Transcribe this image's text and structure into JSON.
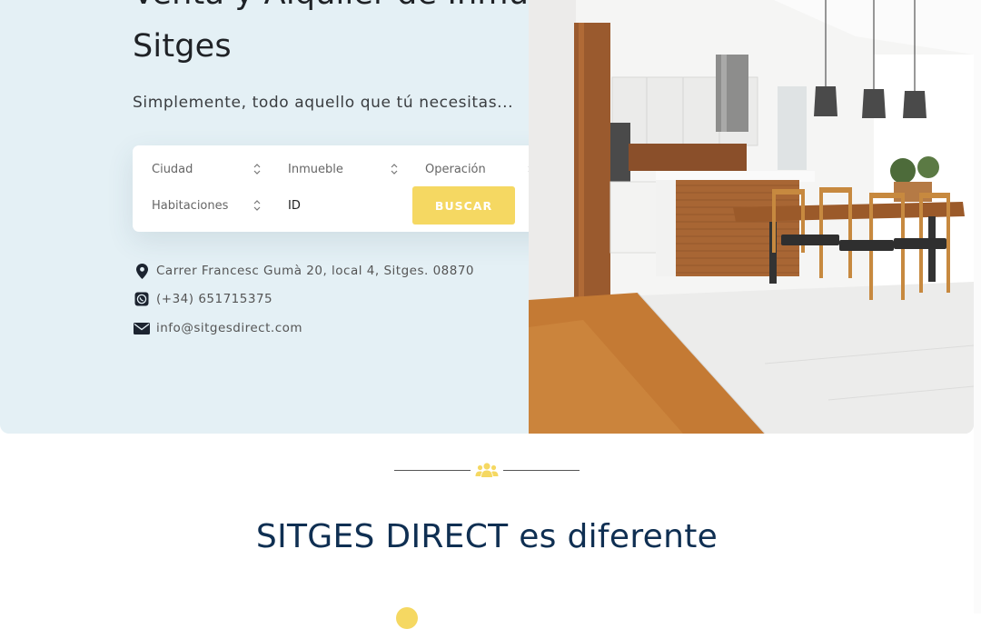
{
  "hero": {
    "title": "Venta y Alquiler de Inmuebles en Sitges",
    "subtitle": "Simplemente, todo aquello que tú necesitas..."
  },
  "search": {
    "fields": {
      "city": "Ciudad",
      "property": "Inmueble",
      "operation": "Operación",
      "rooms": "Habitaciones",
      "id_placeholder": "ID"
    },
    "button_label": "BUSCAR"
  },
  "contact": {
    "address": "Carrer Francesc Gumà 20, local 4, Sitges. 08870",
    "phone": "(+34) 651715375",
    "email": "info@sitgesdirect.com"
  },
  "section": {
    "title_brand": "SITGES DIRECT",
    "title_rest": " es diferente"
  },
  "colors": {
    "accent_yellow": "#f5d862",
    "navy": "#0f2f52",
    "hero_bg": "#e4f0f5"
  },
  "icons": {
    "address": "map-pin-icon",
    "phone": "whatsapp-icon",
    "email": "envelope-icon",
    "divider": "users-group-icon"
  }
}
